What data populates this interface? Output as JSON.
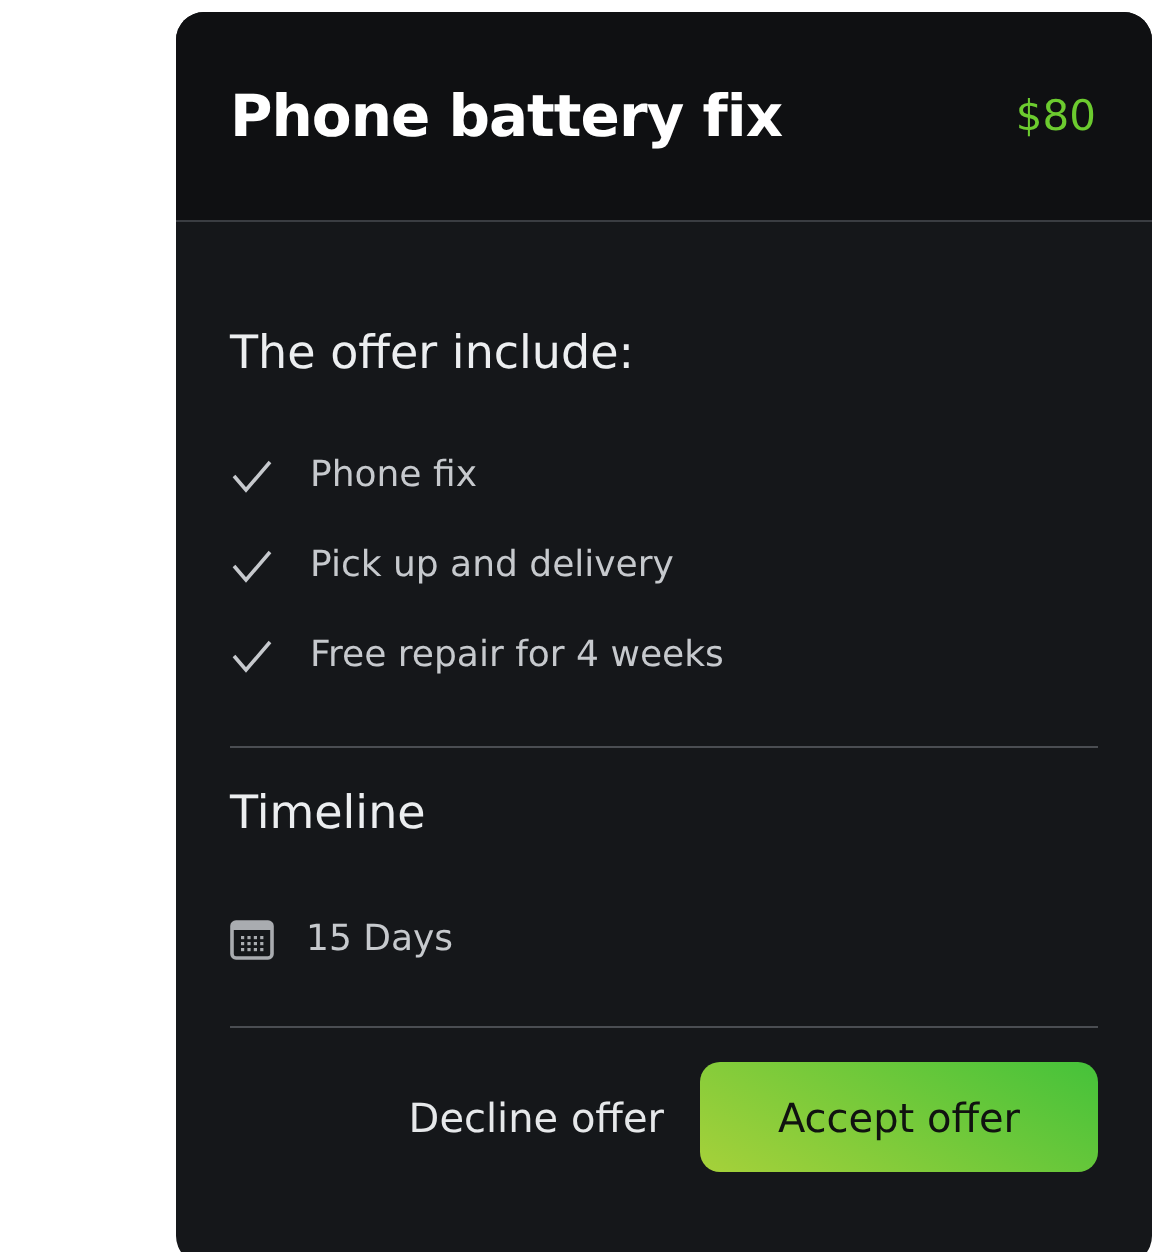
{
  "header": {
    "title": "Phone battery fix",
    "price": "$80"
  },
  "offer": {
    "heading": "The offer include:",
    "items": [
      {
        "label": "Phone fix"
      },
      {
        "label": "Pick up and delivery"
      },
      {
        "label": "Free repair for 4 weeks"
      }
    ]
  },
  "timeline": {
    "heading": "Timeline",
    "duration": "15 Days"
  },
  "buttons": {
    "decline": "Decline offer",
    "accept": "Accept offer"
  }
}
